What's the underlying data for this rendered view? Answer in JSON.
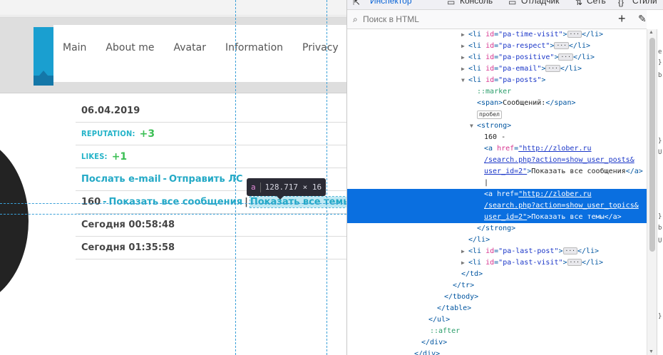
{
  "nav": [
    "Main",
    "About me",
    "Avatar",
    "Information",
    "Privacy"
  ],
  "profile": {
    "date": "06.04.2019",
    "reputation_label": "REPUTATION:",
    "reputation_value": "+3",
    "likes_label": "LIKES:",
    "likes_value": "+1",
    "send_email": "Послать e-mail",
    "send_pm": "Отправить ЛС",
    "posts_count": "160",
    "show_posts": "Показать все сообщения",
    "show_topics": "Показать все темы",
    "last_post": "Сегодня 00:58:48",
    "last_visit": "Сегодня 01:35:58",
    "dash": "-",
    "pipe": "|"
  },
  "tooltip": {
    "tag": "a",
    "size": "128.717 × 16"
  },
  "devtools": {
    "tabs": [
      "Инспектор",
      "Консоль",
      "Отладчик",
      "Сеть",
      "Стили"
    ],
    "search_placeholder": "Поиск в HTML",
    "tree": {
      "li_time_visit_id": "\"pa-time-visit\"",
      "li_respect_id": "\"pa-respect\"",
      "li_positive_id": "\"pa-positive\"",
      "li_email_id": "\"pa-email\"",
      "li_posts_id": "\"pa-posts\"",
      "marker": "::marker",
      "span_text": "Сообщений:",
      "ws_badge": "пробел",
      "strong_text": "160 -",
      "a1_href_1": "\"http://zlober.ru",
      "a1_href_2": "/search.php?action=show_user_posts&",
      "a1_href_3": "user_id=2\"",
      "a1_text": "Показать все сообщения",
      "pipe": "|",
      "a2_href_1": "\"http://zlober.ru",
      "a2_href_2": "/search.php?action=show_user_topics&",
      "a2_href_3": "user_id=2\"",
      "a2_text": "Показать все темы",
      "li_last_post_id": "\"pa-last-post\"",
      "li_last_visit_id": "\"pa-last-visit\"",
      "after": "::after"
    },
    "side_chars": [
      "e",
      "}",
      "b",
      "}",
      "Ur",
      "}",
      "b",
      "Ur",
      "}"
    ]
  },
  "colors": {
    "accent": "#1a9fd0",
    "link": "#23a9c6",
    "label": "#23b3c8",
    "plus": "#3cbf55",
    "selection": "#0a6fe0"
  }
}
